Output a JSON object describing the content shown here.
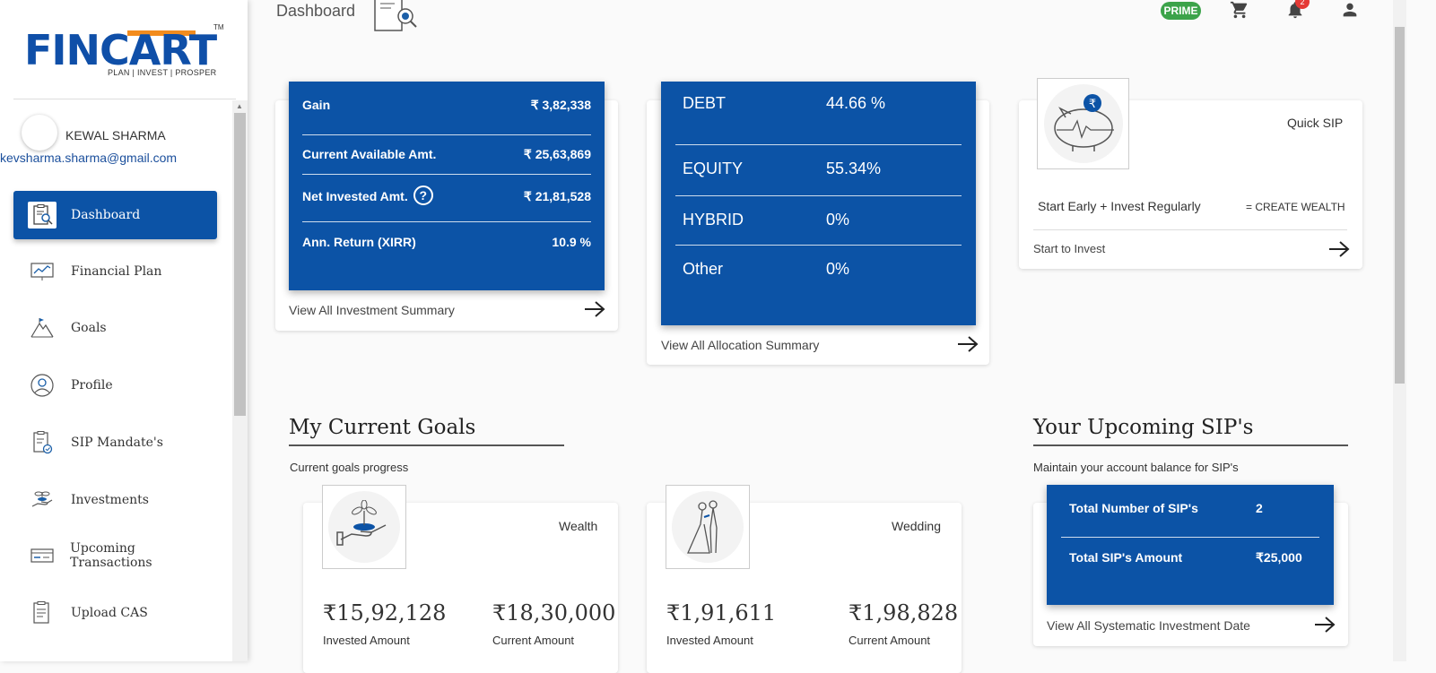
{
  "app": {
    "logo_text": "FINCART",
    "logo_tm": "TM",
    "logo_tagline": "PLAN | INVEST | PROSPER"
  },
  "user": {
    "name": "KEWAL SHARMA",
    "email": "kevsharma.sharma@gmail.com"
  },
  "sidebar": {
    "items": [
      {
        "label": "Dashboard",
        "icon": "dashboard-icon",
        "active": true
      },
      {
        "label": "Financial Plan",
        "icon": "financial-plan-icon"
      },
      {
        "label": "Goals",
        "icon": "goals-icon"
      },
      {
        "label": "Profile",
        "icon": "profile-icon"
      },
      {
        "label": "SIP Mandate's",
        "icon": "sip-mandate-icon"
      },
      {
        "label": "Investments",
        "icon": "investments-icon"
      },
      {
        "label": "Upcoming Transactions",
        "icon": "upcoming-transactions-icon"
      },
      {
        "label": "Upload CAS",
        "icon": "upload-cas-icon"
      }
    ]
  },
  "header": {
    "title": "Dashboard",
    "prime_badge": "PRIME",
    "notification_count": "2",
    "icons": [
      "cart-icon",
      "bell-icon",
      "account-icon"
    ]
  },
  "investment_summary": {
    "rows": [
      {
        "label": "Gain",
        "value": "₹ 3,82,338"
      },
      {
        "label": "Current Available Amt.",
        "value": "₹ 25,63,869"
      },
      {
        "label": "Net Invested Amt.",
        "value": "₹ 21,81,528"
      },
      {
        "label": "Ann. Return (XIRR)",
        "value": "10.9 %"
      }
    ],
    "link": "View All Investment Summary"
  },
  "allocation_summary": {
    "rows": [
      {
        "label": "DEBT",
        "value": "44.66 %"
      },
      {
        "label": "EQUITY",
        "value": "55.34%"
      },
      {
        "label": "HYBRID",
        "value": "0%"
      },
      {
        "label": "Other",
        "value": "0%"
      }
    ],
    "link": "View All Allocation Summary"
  },
  "quick_sip": {
    "title": "Quick SIP",
    "tagline": "Start Early + Invest Regularly",
    "tagline_right": "= CREATE WEALTH",
    "link": "Start to Invest"
  },
  "goals": {
    "heading": "My Current Goals",
    "subheading": "Current goals progress",
    "items": [
      {
        "name": "Wealth",
        "invested": "₹15,92,128",
        "current": "₹18,30,000",
        "invested_label": "Invested Amount",
        "current_label": "Current Amount"
      },
      {
        "name": "Wedding",
        "invested": "₹1,91,611",
        "current": "₹1,98,828",
        "invested_label": "Invested Amount",
        "current_label": "Current Amount"
      }
    ]
  },
  "upcoming_sip": {
    "heading": "Your Upcoming SIP's",
    "subheading": "Maintain your account balance for SIP's",
    "rows": [
      {
        "label": "Total Number of SIP's",
        "value": "2"
      },
      {
        "label": "Total SIP's Amount",
        "value": "₹25,000"
      }
    ],
    "link": "View All Systematic Investment Date"
  },
  "colors": {
    "primary": "#0c53a6",
    "accent": "#f28c1e",
    "prime": "#3ca34a",
    "badge": "#e53935"
  }
}
